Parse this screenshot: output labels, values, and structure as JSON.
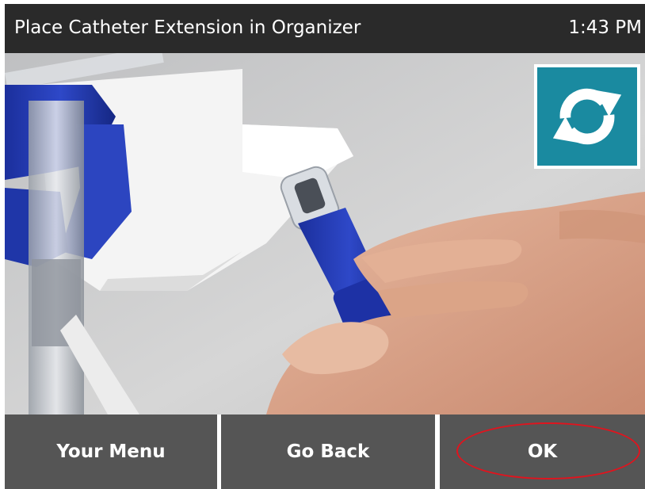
{
  "header": {
    "title": "Place Catheter Extension in Organizer",
    "time": "1:43 PM"
  },
  "photo": {
    "icon": "catheter-organizer-photo"
  },
  "refresh": {
    "icon": "refresh-icon",
    "color": "#1a8aa0"
  },
  "footer": {
    "menu_label": "Your Menu",
    "back_label": "Go Back",
    "ok_label": "OK"
  },
  "colors": {
    "header_bg": "#2a2a2a",
    "button_bg": "#555555",
    "accent": "#1a8aa0",
    "highlight": "#e0141e"
  }
}
